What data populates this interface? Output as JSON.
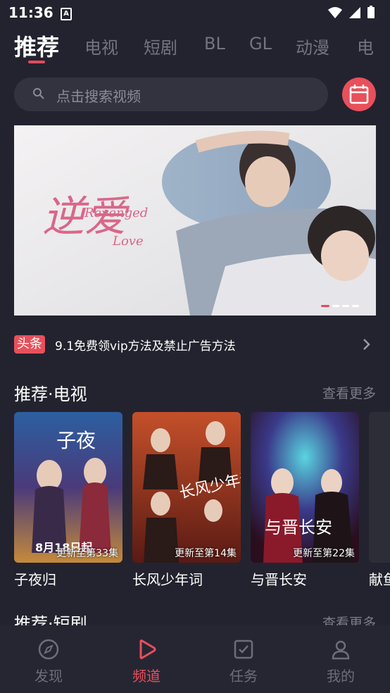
{
  "status_bar": {
    "time": "11:36",
    "notif_icon": "A"
  },
  "tabs": [
    {
      "label": "推荐",
      "active": true
    },
    {
      "label": "电视"
    },
    {
      "label": "短剧"
    },
    {
      "label": "BL"
    },
    {
      "label": "GL"
    },
    {
      "label": "动漫"
    },
    {
      "label": "电"
    }
  ],
  "search": {
    "placeholder": "点击搜索视频"
  },
  "banner": {
    "title_art": "逆爱",
    "subtitle_art": "Revenged Love"
  },
  "notice": {
    "tag": "头条",
    "text": "9.1免费领vip方法及禁止广告方法"
  },
  "section_tv": {
    "title": "推荐·电视",
    "more": "查看更多",
    "items": [
      {
        "name": "子夜归",
        "badge": "更新至第33集",
        "poster_text": "8月18日起"
      },
      {
        "name": "长风少年词",
        "badge": "更新至第14集",
        "poster_text": "长风少年词"
      },
      {
        "name": "与晋长安",
        "badge": "更新至第22集",
        "poster_text": "与晋长安"
      },
      {
        "name": "献鱼",
        "badge": "",
        "poster_text": ""
      }
    ]
  },
  "section_short": {
    "title": "推荐·短剧",
    "more": "查看更多"
  },
  "bottom_nav": [
    {
      "label": "发现",
      "icon": "compass-icon"
    },
    {
      "label": "频道",
      "icon": "play-icon",
      "active": true
    },
    {
      "label": "任务",
      "icon": "task-check-icon"
    },
    {
      "label": "我的",
      "icon": "user-icon"
    }
  ],
  "colors": {
    "accent": "#e8505b",
    "background": "#23232f",
    "muted": "#74747f"
  }
}
